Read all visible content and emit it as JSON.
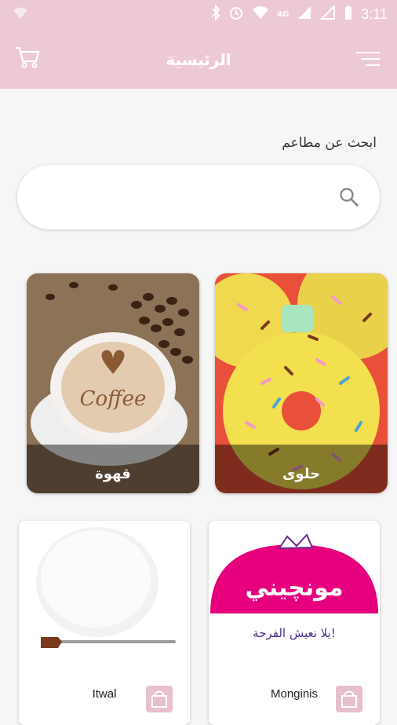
{
  "status_bar": {
    "time": "3:11",
    "network": "4G"
  },
  "header": {
    "title": "الرئيسية"
  },
  "search": {
    "label": "ابحث عن مطاعم",
    "placeholder": ""
  },
  "categories": [
    {
      "label": "قهوة"
    },
    {
      "label": "حلوى"
    }
  ],
  "restaurants": [
    {
      "name": "Itwal"
    },
    {
      "name": "Monginis",
      "logo_text": "مونچيني",
      "tagline": "يلا نعيش الفرحة!"
    }
  ],
  "colors": {
    "brand": "#ecc9d5",
    "accent": "#e6007e",
    "bag": "#e7bfce"
  }
}
